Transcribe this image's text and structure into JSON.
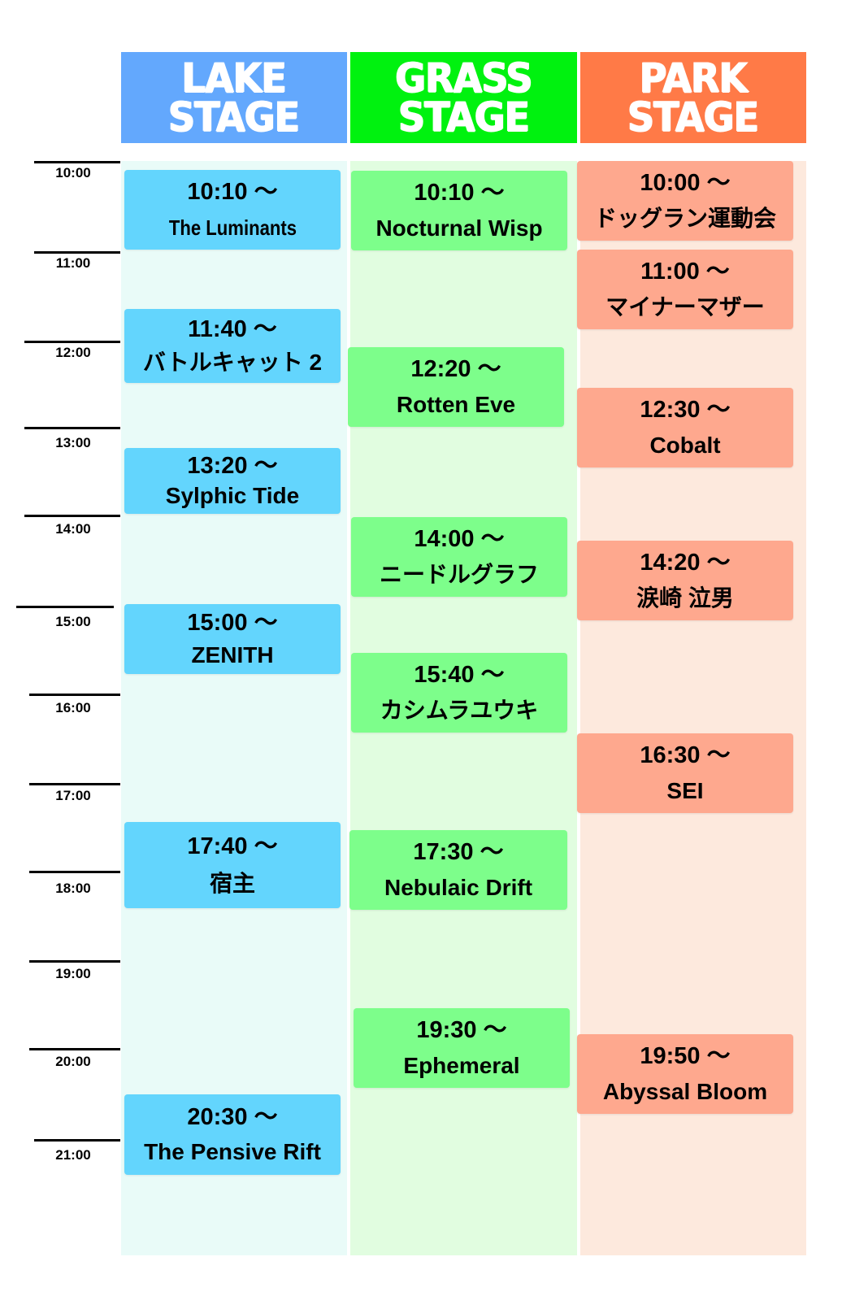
{
  "stages": {
    "lake": {
      "line1": "LAKE",
      "line2": "STAGE"
    },
    "grass": {
      "line1": "GRASS",
      "line2": "STAGE"
    },
    "park": {
      "line1": "PARK",
      "line2": "STAGE"
    }
  },
  "colors": {
    "lake_header": "#63a8fd",
    "grass_header": "#00f20f",
    "park_header": "#ff7a47",
    "lake_slot": "#63d5fd",
    "grass_slot": "#7dfe8b",
    "park_slot": "#fea88e"
  },
  "times": [
    "10:00",
    "11:00",
    "12:00",
    "13:00",
    "14:00",
    "15:00",
    "16:00",
    "17:00",
    "18:00",
    "19:00",
    "20:00",
    "21:00"
  ],
  "lake": [
    {
      "time": "10:10 ～",
      "name": "The Luminants"
    },
    {
      "time": "11:40 ～",
      "name": "バトルキャット 2"
    },
    {
      "time": "13:20 ～",
      "name": "Sylphic Tide"
    },
    {
      "time": "15:00 ～",
      "name": "ZENITH"
    },
    {
      "time": "17:40 ～",
      "name": "宿主"
    },
    {
      "time": "20:30 ～",
      "name": "The Pensive Rift"
    }
  ],
  "grass": [
    {
      "time": "10:10 ～",
      "name": "Nocturnal Wisp"
    },
    {
      "time": "12:20 ～",
      "name": "Rotten Eve"
    },
    {
      "time": "14:00 ～",
      "name": "ニードルグラフ"
    },
    {
      "time": "15:40 ～",
      "name": "カシムラユウキ"
    },
    {
      "time": "17:30 ～",
      "name": "Nebulaic Drift"
    },
    {
      "time": "19:30 ～",
      "name": "Ephemeral"
    }
  ],
  "park": [
    {
      "time": "10:00 ～",
      "name": "ドッグラン運動会"
    },
    {
      "time": "11:00 ～",
      "name": "マイナーマザー"
    },
    {
      "time": "12:30 ～",
      "name": "Cobalt"
    },
    {
      "time": "14:20 ～",
      "name": "涙崎 泣男"
    },
    {
      "time": "16:30 ～",
      "name": "SEI"
    },
    {
      "time": "19:50 ～",
      "name": "Abyssal Bloom"
    }
  ]
}
